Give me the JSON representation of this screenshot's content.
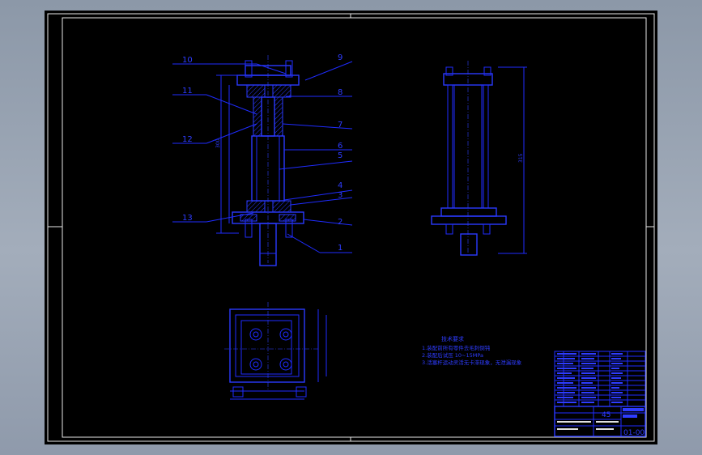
{
  "drawing": {
    "balloons": [
      "10",
      "11",
      "12",
      "13",
      "9",
      "8",
      "7",
      "6",
      "5",
      "4",
      "3",
      "2",
      "1"
    ],
    "tech_req": {
      "title": "技术要求",
      "lines": [
        "1.装配前所有零件去毛刺倒钝",
        "2.装配后试压 10~15MPa",
        "3.活塞杆运动灵活无卡滞现象，无泄漏现象"
      ]
    },
    "title_block": {
      "material": "45",
      "drawing_no": "01-00"
    }
  },
  "colors": {
    "sheet": "#000000",
    "lines": "#1f2cff",
    "frame": "#e8e8e8"
  }
}
